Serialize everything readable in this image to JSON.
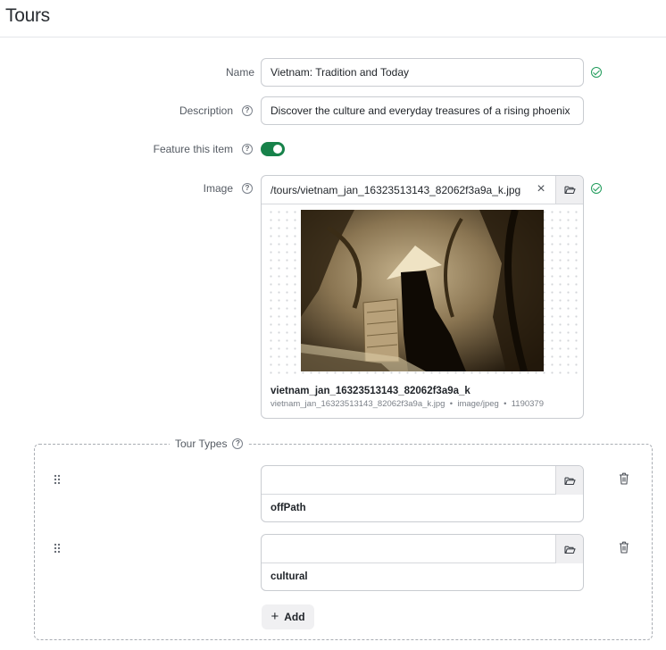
{
  "page": {
    "title": "Tours"
  },
  "form": {
    "name": {
      "label": "Name",
      "value": "Vietnam: Tradition and Today"
    },
    "description": {
      "label": "Description",
      "value": "Discover the culture and everyday treasures of a rising phoenix"
    },
    "feature": {
      "label": "Feature this item",
      "enabled": true
    },
    "image": {
      "label": "Image",
      "path": "/tours/vietnam_jan_16323513143_82062f3a9a_k.jpg",
      "file_title": "vietnam_jan_16323513143_82062f3a9a_k",
      "file_name": "vietnam_jan_16323513143_82062f3a9a_k.jpg",
      "mime": "image/jpeg",
      "size": "1190379"
    },
    "tour_types": {
      "label": "Tour Types",
      "items": [
        {
          "value": "",
          "name": "offPath"
        },
        {
          "value": "",
          "name": "cultural"
        }
      ],
      "add_label": "Add"
    }
  },
  "colors": {
    "accent": "#17824a",
    "valid": "#1f9b5a"
  },
  "icons": {
    "help": "help-circle-icon",
    "valid": "check-circle-icon",
    "clear": "close-icon",
    "browse": "folder-icon",
    "drag": "drag-handle-icon",
    "delete": "trash-icon",
    "add": "plus-icon"
  }
}
